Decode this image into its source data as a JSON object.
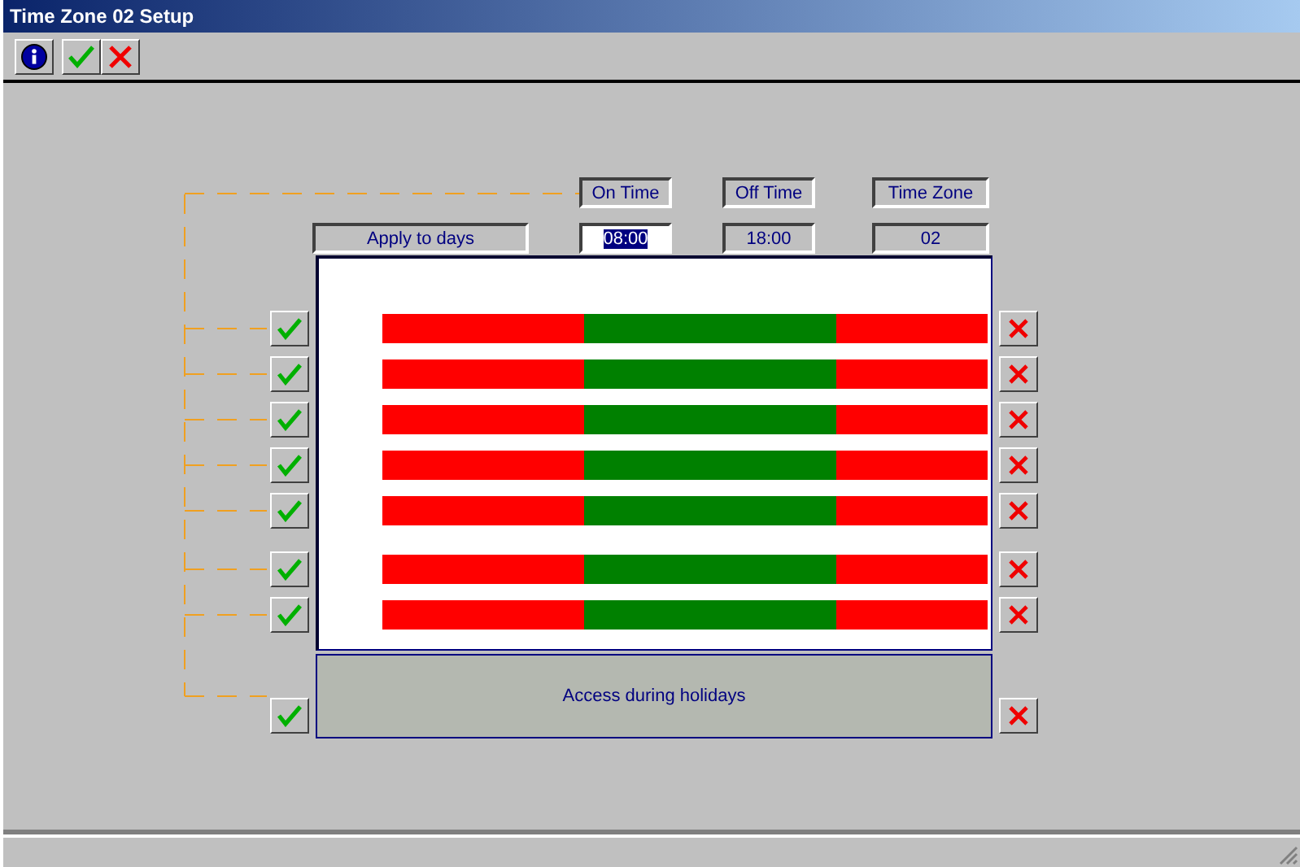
{
  "window": {
    "title": "Time Zone 02 Setup"
  },
  "toolbar": [
    {
      "kind": "info"
    },
    {
      "kind": "accept"
    },
    {
      "kind": "cancel"
    }
  ],
  "headers": {
    "on_time": "On Time",
    "off_time": "Off Time",
    "time_zone": "Time Zone",
    "apply": "Apply to days"
  },
  "fields": {
    "on_time": {
      "value": "08:00",
      "selected": true
    },
    "off_time": {
      "value": "18:00",
      "selected": false
    },
    "time_zone": {
      "value": "02",
      "selected": false
    }
  },
  "days": [
    {
      "kind": "weekday"
    },
    {
      "kind": "weekday"
    },
    {
      "kind": "weekday"
    },
    {
      "kind": "weekday"
    },
    {
      "kind": "weekday"
    },
    {
      "kind": "weekend"
    },
    {
      "kind": "weekend"
    }
  ],
  "holidays": {
    "label": "Access during holidays"
  }
}
